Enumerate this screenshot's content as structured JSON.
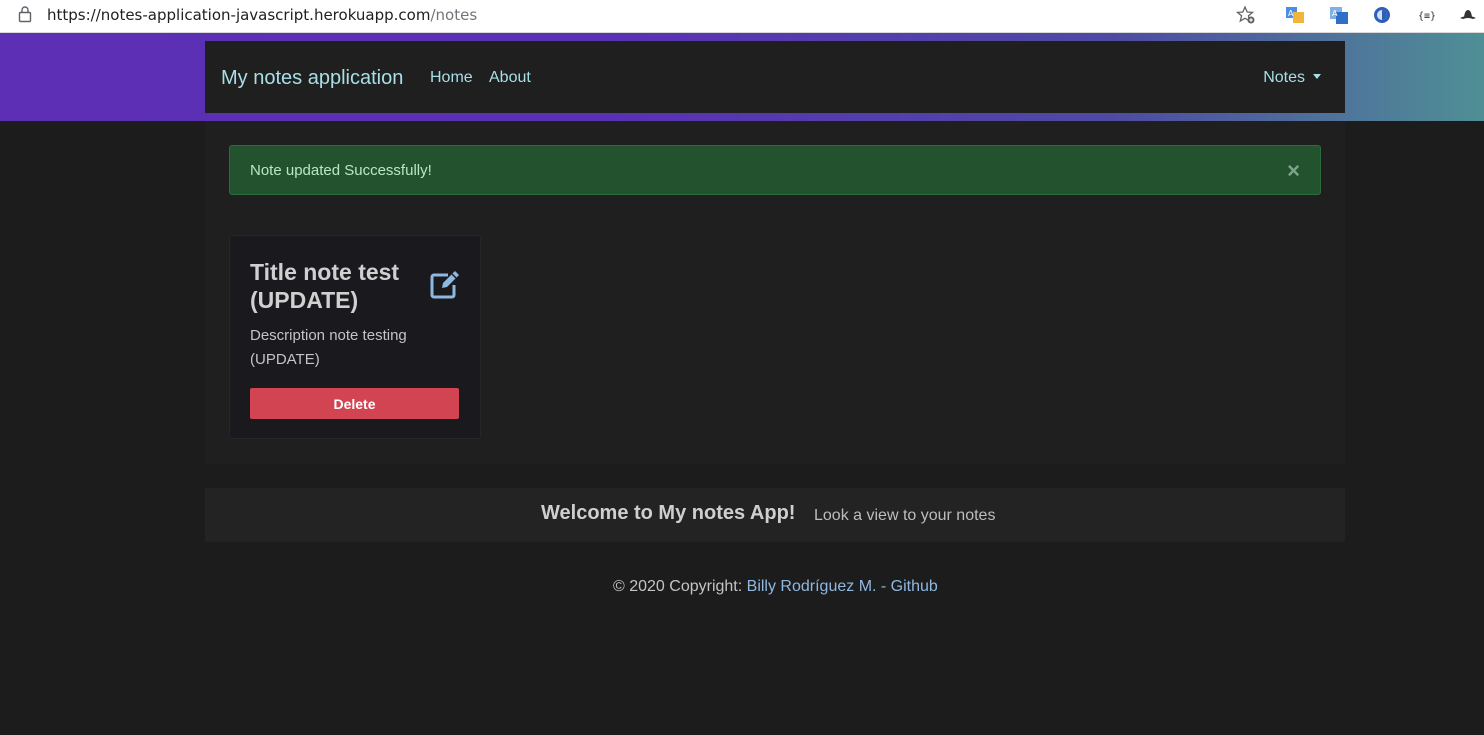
{
  "browser": {
    "url_host": "https://notes-application-javascript.herokuapp.com",
    "url_path": "/notes",
    "icons": [
      "lock-icon",
      "bookmark-star-icon",
      "translate-icon",
      "translate-alt-icon",
      "extension-icon",
      "json-viewer-icon",
      "profile-hat-icon"
    ]
  },
  "navbar": {
    "brand": "My notes application",
    "links": [
      {
        "label": "Home"
      },
      {
        "label": "About"
      }
    ],
    "notes_dropdown": "Notes"
  },
  "alert": {
    "message": "Note updated Successfully!",
    "close_symbol": "×",
    "color": "#23522f"
  },
  "note": {
    "title": "Title note test (UPDATE)",
    "description": "Description note testing (UPDATE)",
    "delete_label": "Delete",
    "delete_color": "#d24452",
    "edit_icon": "edit-icon",
    "accent": "#8fb8e0"
  },
  "footer": {
    "welcome_title": "Welcome to My notes App!",
    "welcome_subtitle": "Look a view to your notes",
    "copyright_prefix": "© 2020 Copyright: ",
    "copyright_link": "Billy Rodríguez M. - Github"
  }
}
